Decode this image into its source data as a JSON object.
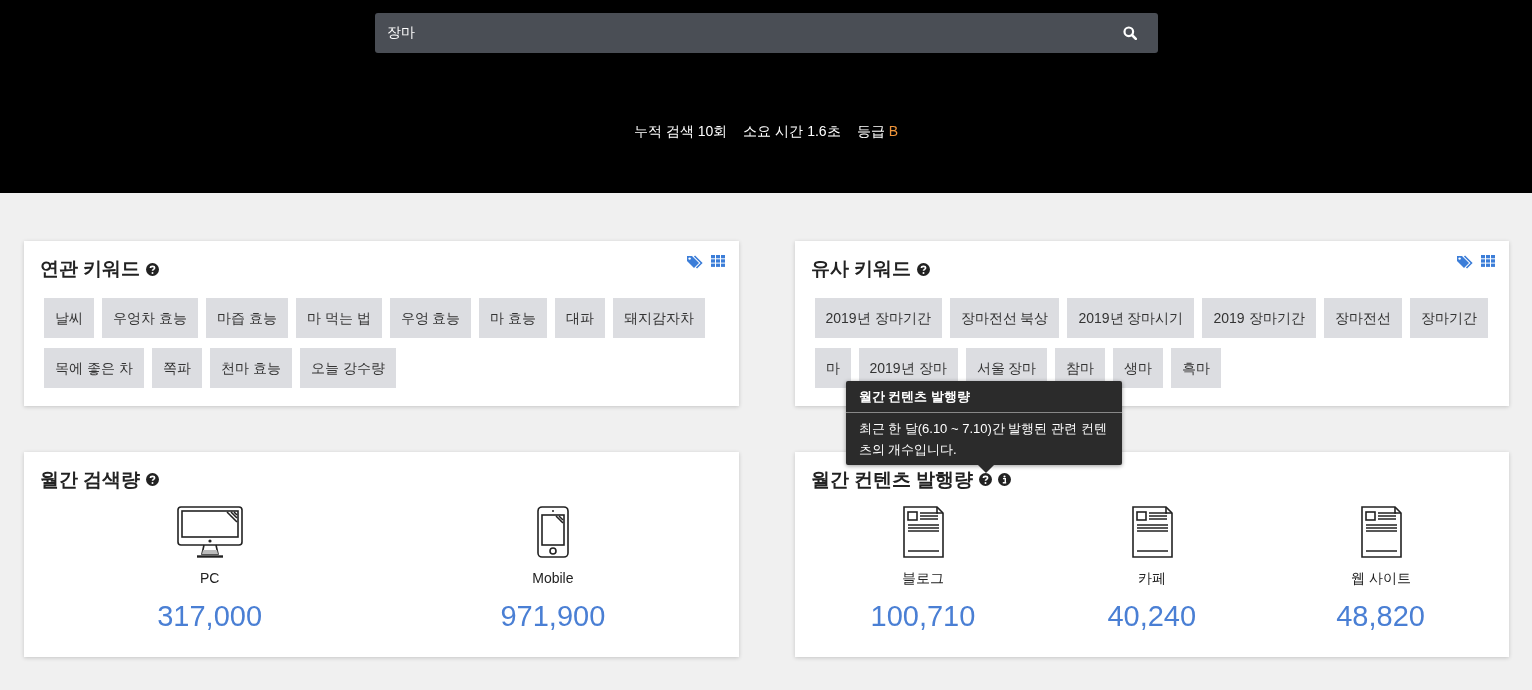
{
  "search": {
    "value": "장마"
  },
  "stats": [
    {
      "text": "누적 검색 10회"
    },
    {
      "text": "소요 시간 1.6초"
    }
  ],
  "grade": {
    "label": "등급",
    "value": "B"
  },
  "keyword_panels": [
    {
      "title": "연관 키워드",
      "keywords": [
        "날씨",
        "우엉차 효능",
        "마즙 효능",
        "마 먹는 법",
        "우엉 효능",
        "마 효능",
        "대파",
        "돼지감자차",
        "목에 좋은 차",
        "쪽파",
        "천마 효능",
        "오늘 강수량"
      ]
    },
    {
      "title": "유사 키워드",
      "keywords": [
        "2019년 장마기간",
        "장마전선 북상",
        "2019년 장마시기",
        "2019 장마기간",
        "장마전선",
        "장마기간",
        "마",
        "2019년 장마",
        "서울 장마",
        "참마",
        "생마",
        "흑마"
      ]
    }
  ],
  "metric_panels": [
    {
      "title": "월간 검색량",
      "info": false,
      "items": [
        {
          "kind": "monitor",
          "label": "PC",
          "value": "317,000"
        },
        {
          "kind": "phone",
          "label": "Mobile",
          "value": "971,900"
        }
      ]
    },
    {
      "title": "월간 컨텐츠 발행량",
      "info": true,
      "items": [
        {
          "kind": "document",
          "label": "블로그",
          "value": "100,710"
        },
        {
          "kind": "document",
          "label": "카페",
          "value": "40,240"
        },
        {
          "kind": "document",
          "label": "웹 사이트",
          "value": "48,820"
        }
      ]
    }
  ],
  "tooltip": {
    "title": "월간 컨텐츠 발행량",
    "body": "최근 한 달(6.10 ~ 7.10)간 발행된 관련 컨텐츠의 개수입니다."
  }
}
